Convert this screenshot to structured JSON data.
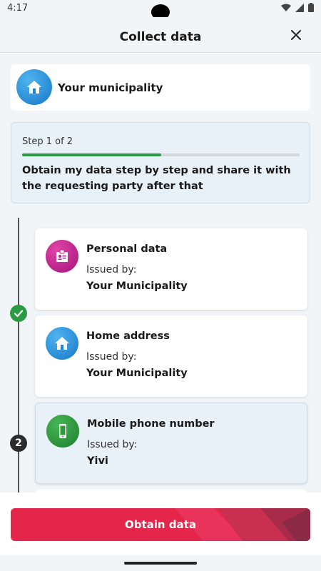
{
  "status_bar": {
    "time": "4:17"
  },
  "header": {
    "title": "Collect data"
  },
  "municipality": {
    "label": "Your municipality",
    "icon": "house-icon"
  },
  "progress": {
    "step_label": "Step 1 of 2",
    "fraction": 0.5,
    "description": "Obtain my data step by step and share it with the requesting party after that"
  },
  "credentials": [
    {
      "title": "Personal data",
      "issued_by_label": "Issued by:",
      "issuer": "Your Municipality",
      "icon": "id-badge-icon",
      "color": "#c2168f"
    },
    {
      "title": "Home address",
      "issued_by_label": "Issued by:",
      "issuer": "Your Municipality",
      "icon": "house-icon",
      "color": "#1e88d6"
    },
    {
      "title": "Mobile phone number",
      "issued_by_label": "Issued by:",
      "issuer": "Yivi",
      "icon": "phone-icon",
      "color": "#2e9a3e"
    }
  ],
  "timeline": {
    "step_number": "2"
  },
  "actions": {
    "obtain_label": "Obtain data"
  },
  "colors": {
    "accent": "#e3264a",
    "progress": "#2b9a45",
    "background": "#f2f5f7"
  }
}
